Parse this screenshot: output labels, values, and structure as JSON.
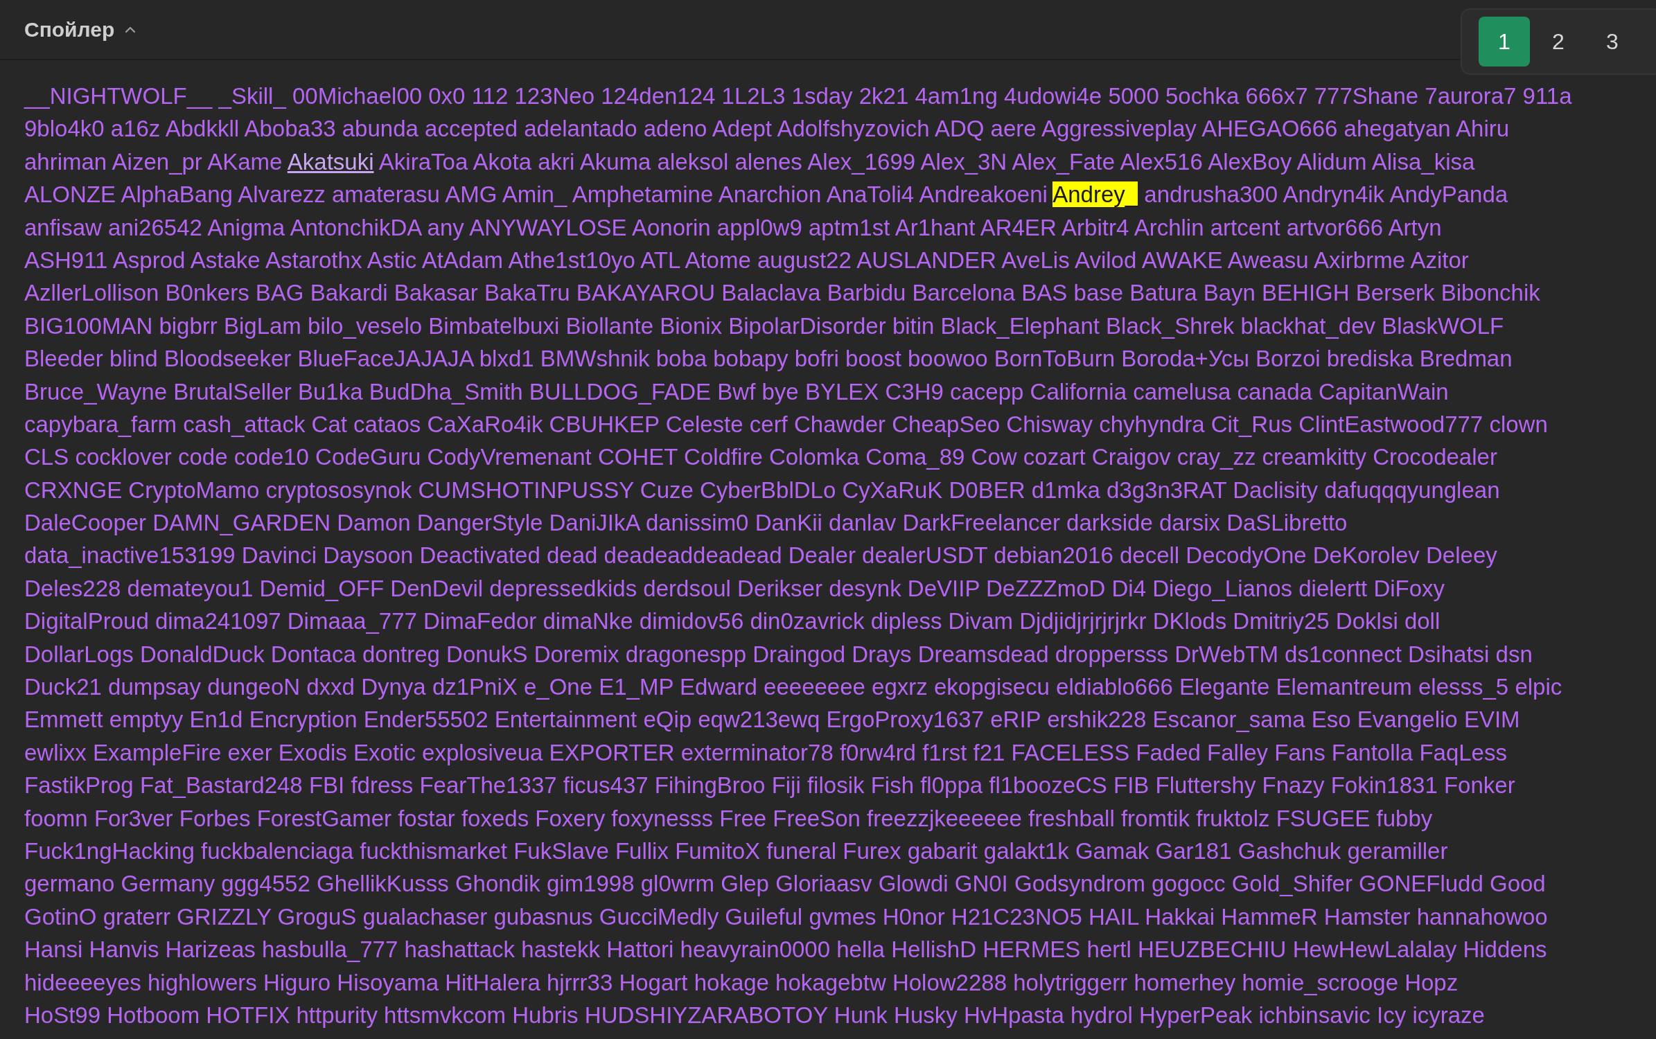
{
  "spoiler": {
    "title": "Спойлер",
    "expanded": true
  },
  "pagination": [
    {
      "label": "1",
      "selected": true
    },
    {
      "label": "2",
      "selected": false
    },
    {
      "label": "3",
      "selected": false
    }
  ],
  "lines": [
    [
      "__NIGHTWOLF__",
      "_Skill_",
      "00Michael00",
      "0x0",
      "112",
      "123Neo",
      "124den124",
      "1L2L3",
      "1sday",
      "2k21",
      "4am1ng",
      "4udowi4e",
      "5000",
      "5ochka",
      "666x7",
      "777Shane",
      "7aurora7",
      "911a"
    ],
    [
      "9blo4k0",
      "a16z",
      "Abdkkll",
      "Aboba33",
      "abunda",
      "accepted",
      "adelantado",
      "adeno",
      "Adept",
      "Adolfshyzovich",
      "ADQ",
      "aere",
      "Aggressiveplay",
      "AHEGAO666",
      "ahegatyan",
      "Ahiru"
    ],
    [
      "ahriman",
      "Aizen_pr",
      "AKame",
      {
        "text": "Akatsuki",
        "kind": "hovered"
      },
      "AkiraToa",
      "Akota",
      "akri",
      "Akuma",
      "aleksol",
      "alenes",
      "Alex_1699",
      "Alex_3N",
      "Alex_Fate",
      "Alex516",
      "AlexBoy",
      "Alidum",
      "Alisa_kisa"
    ],
    [
      "ALONZE",
      "AlphaBang",
      "Alvarezz",
      "amaterasu",
      "AMG",
      "Amin_",
      "Amphetamine",
      "Anarchion",
      "AnaToli4",
      "Andreakoeni",
      {
        "text": "Andrey_",
        "kind": "highlighted"
      },
      "andrusha300",
      "Andryn4ik",
      "AndyPanda"
    ],
    [
      "anfisaw",
      "ani26542",
      "Anigma",
      "AntonchikDA",
      "any",
      "ANYWAYLOSE",
      "Aonorin",
      "appl0w9",
      "aptm1st",
      "Ar1hant",
      "AR4ER",
      "Arbitr4",
      "Archlin",
      "artcent",
      "artvor666",
      "Artyn"
    ],
    [
      "ASH911",
      "Asprod",
      "Astake",
      "Astarothx",
      "Astic",
      "AtAdam",
      "Athe1st10yo",
      "ATL",
      "Atome",
      "august22",
      "AUSLANDER",
      "AveLis",
      "Avilod",
      "AWAKE",
      "Aweasu",
      "Axirbrme",
      "Azitor"
    ],
    [
      "AzllerLollison",
      "B0nkers",
      "BAG",
      "Bakardi",
      "Bakasar",
      "BakaTru",
      "BAKAYAROU",
      "Balaclava",
      "Barbidu",
      "Barcelona",
      "BAS",
      "base",
      "Batura",
      "Bayn",
      "BEHIGH",
      "Berserk",
      "Bibonchik"
    ],
    [
      "BIG100MAN",
      "bigbrr",
      "BigLam",
      "bilo_veselo",
      "Bimbatelbuxi",
      "Biollante",
      "Bionix",
      "BipolarDisorder",
      "bitin",
      "Black_Elephant",
      "Black_Shrek",
      "blackhat_dev",
      "BlaskWOLF"
    ],
    [
      "Bleeder",
      "blind",
      "Bloodseeker",
      "BlueFaceJAJAJA",
      "blxd1",
      "BMWshnik",
      "boba",
      "bobapy",
      "bofri",
      "boost",
      "boowoo",
      "BornToBurn",
      "Boroda+Усы",
      "Borzoi",
      "brediska",
      "Bredman"
    ],
    [
      "Bruce_Wayne",
      "BrutalSeller",
      "Bu1ka",
      "BudDha_Smith",
      "BULLDOG_FADE",
      "Bwf",
      "bye",
      "BYLEX",
      "C3H9",
      "cacepp",
      "California",
      "camelusa",
      "canada",
      "CapitanWain"
    ],
    [
      "capybara_farm",
      "cash_attack",
      "Cat",
      "cataos",
      "CaXaRo4ik",
      "CBUHKEP",
      "Celeste",
      "cerf",
      "Chawder",
      "CheapSeo",
      "Chisway",
      "chyhyndra",
      "Cit_Rus",
      "ClintEastwood777",
      "clown"
    ],
    [
      "CLS",
      "cocklover",
      "code",
      "code10",
      "CodeGuru",
      "CodyVremenant",
      "COHET",
      "Coldfire",
      "Colomka",
      "Coma_89",
      "Cow",
      "cozart",
      "Craigov",
      "cray_zz",
      "creamkitty",
      "Crocodealer"
    ],
    [
      "CRXNGE",
      "CryptoMamo",
      "cryptososynok",
      "CUMSHOTINPUSSY",
      "Cuze",
      "CyberBblDLo",
      "CyXaRuK",
      "D0BER",
      "d1mka",
      "d3g3n3RAT",
      "Daclisity",
      "dafuqqqyunglean"
    ],
    [
      "DaleCooper",
      "DAMN_GARDEN",
      "Damon",
      "DangerStyle",
      "DaniJIkA",
      "danissim0",
      "DanKii",
      "danlav",
      "DarkFreelancer",
      "darkside",
      "darsix",
      "DaSLibretto"
    ],
    [
      "data_inactive153199",
      "Davinci",
      "Daysoon",
      "Deactivated",
      "dead",
      "deadeaddeadead",
      "Dealer",
      "dealerUSDT",
      "debian2016",
      "decell",
      "DecodyOne",
      "DeKorolev",
      "Deleey"
    ],
    [
      "Deles228",
      "demateyou1",
      "Demid_OFF",
      "DenDevil",
      "depressedkids",
      "derdsoul",
      "Derikser",
      "desynk",
      "DeVIIP",
      "DeZZZmoD",
      "Di4",
      "Diego_Lianos",
      "dielertt",
      "DiFoxy"
    ],
    [
      "DigitalProud",
      "dima241097",
      "Dimaaa_777",
      "DimaFedor",
      "dimaNke",
      "dimidov56",
      "din0zavrick",
      "dipless",
      "Divam",
      "Djdjidjrjrjrjrkr",
      "DKlods",
      "Dmitriy25",
      "Doklsi",
      "doll"
    ],
    [
      "DollarLogs",
      "DonaldDuck",
      "Dontaca",
      "dontreg",
      "DonukS",
      "Doremix",
      "dragonespp",
      "Draingod",
      "Drays",
      "Dreamsdead",
      "droppersss",
      "DrWebTM",
      "ds1connect",
      "Dsihatsi",
      "dsn"
    ],
    [
      "Duck21",
      "dumpsay",
      "dungeoN",
      "dxxd",
      "Dynya",
      "dz1PniX",
      "e_One",
      "E1_MP",
      "Edward",
      "eeeeeeee",
      "egxrz",
      "ekopgisecu",
      "eldiablo666",
      "Elegante",
      "Elemantreum",
      "elesss_5",
      "elpic"
    ],
    [
      "Emmett",
      "emptyy",
      "En1d",
      "Encryption",
      "Ender55502",
      "Entertainment",
      "eQip",
      "eqw213ewq",
      "ErgoProxy1637",
      "eRIP",
      "ershik228",
      "Escanor_sama",
      "Eso",
      "Evangelio",
      "EVIM"
    ],
    [
      "ewlixx",
      "ExampleFire",
      "exer",
      "Exodis",
      "Exotic",
      "explosiveua",
      "EXPORTER",
      "exterminator78",
      "f0rw4rd",
      "f1rst",
      "f21",
      "FACELESS",
      "Faded",
      "Falley",
      "Fans",
      "Fantolla",
      "FaqLess"
    ],
    [
      "FastikProg",
      "Fat_Bastard248",
      "FBI",
      "fdress",
      "FearThe1337",
      "ficus437",
      "FihingBroo",
      "Fiji",
      "filosik",
      "Fish",
      "fl0ppa",
      "fl1boozeCS",
      "FIB",
      "Fluttershy",
      "Fnazy",
      "Fokin1831",
      "Fonker"
    ],
    [
      "foomn",
      "For3ver",
      "Forbes",
      "ForestGamer",
      "fostar",
      "foxeds",
      "Foxery",
      "foxynesss",
      "Free",
      "FreeSon",
      "freezzjkeeeeee",
      "freshball",
      "fromtik",
      "fruktolz",
      "FSUGEE",
      "fubby"
    ],
    [
      "Fuck1ngHacking",
      "fuckbalenciaga",
      "fuckthismarket",
      "FukSlave",
      "Fullix",
      "FumitoX",
      "funeral",
      "Furex",
      "gabarit",
      "galakt1k",
      "Gamak",
      "Gar181",
      "Gashchuk",
      "geramiller"
    ],
    [
      "germano",
      "Germany",
      "ggg4552",
      "GhellikKusss",
      "Ghondik",
      "gim1998",
      "gl0wrm",
      "Glep",
      "Gloriaasv",
      "Glowdi",
      "GN0I",
      "Godsyndrom",
      "gogocc",
      "Gold_Shifer",
      "GONEFludd",
      "Good"
    ],
    [
      "GotinO",
      "graterr",
      "GRIZZLY",
      "GroguS",
      "gualachaser",
      "gubasnus",
      "GucciMedly",
      "Guileful",
      "gvmes",
      "H0nor",
      "H21C23NO5",
      "HAIL",
      "Hakkai",
      "HammeR",
      "Hamster",
      "hannahowoo"
    ],
    [
      "Hansi",
      "Hanvis",
      "Harizeas",
      "hasbulla_777",
      "hashattack",
      "hastekk",
      "Hattori",
      "heavyrain0000",
      "hella",
      "HellishD",
      "HERMES",
      "hertl",
      "HEUZBECHIU",
      "HewHewLalalay",
      "Hiddens"
    ],
    [
      "hideeeeyes",
      "highlowers",
      "Higuro",
      "Hisoyama",
      "HitHalera",
      "hjrrr33",
      "Hogart",
      "hokage",
      "hokagebtw",
      "Holow2288",
      "holytriggerr",
      "homerhey",
      "homie_scrooge",
      "Hopz"
    ],
    [
      "HoSt99",
      "Hotboom",
      "HOTFIX",
      "httpurity",
      "httsmvkcom",
      "Hubris",
      "HUDSHIYZARABOTOY",
      "Hunk",
      "Husky",
      "HvHpasta",
      "hydrol",
      "HyperPeak",
      "ichbinsavic",
      "Icy",
      "icyraze"
    ]
  ]
}
